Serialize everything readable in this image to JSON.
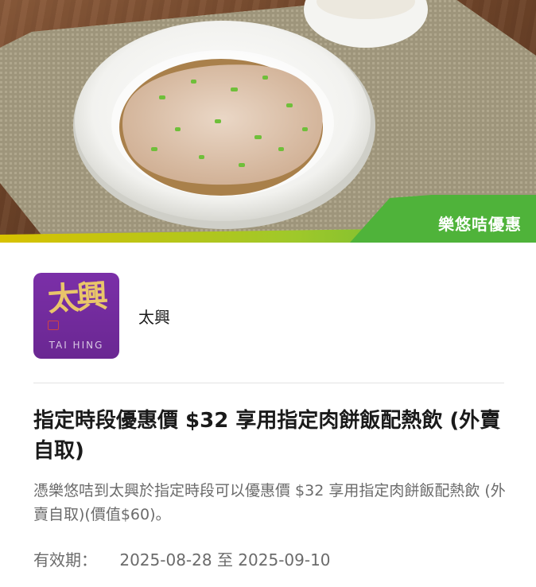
{
  "hero": {
    "promo_label": "樂悠咭優惠"
  },
  "merchant": {
    "name": "太興",
    "logo_glyphs": "太興",
    "logo_en": "TAI HING"
  },
  "offer": {
    "title": "指定時段優惠價 $32 享用指定肉餅飯配熱飲 (外賣自取)",
    "description": "憑樂悠咭到太興於指定時段可以優惠價 $32 享用指定肉餅飯配熱飲 (外賣自取)(價值$60)。"
  },
  "validity": {
    "label": "有效期：",
    "range": "2025-08-28 至 2025-09-10"
  },
  "colors": {
    "promo_green": "#5dbb2f",
    "promo_yellow": "#d8c200",
    "logo_purple": "#6a2792",
    "logo_gold": "#e9c56a"
  }
}
